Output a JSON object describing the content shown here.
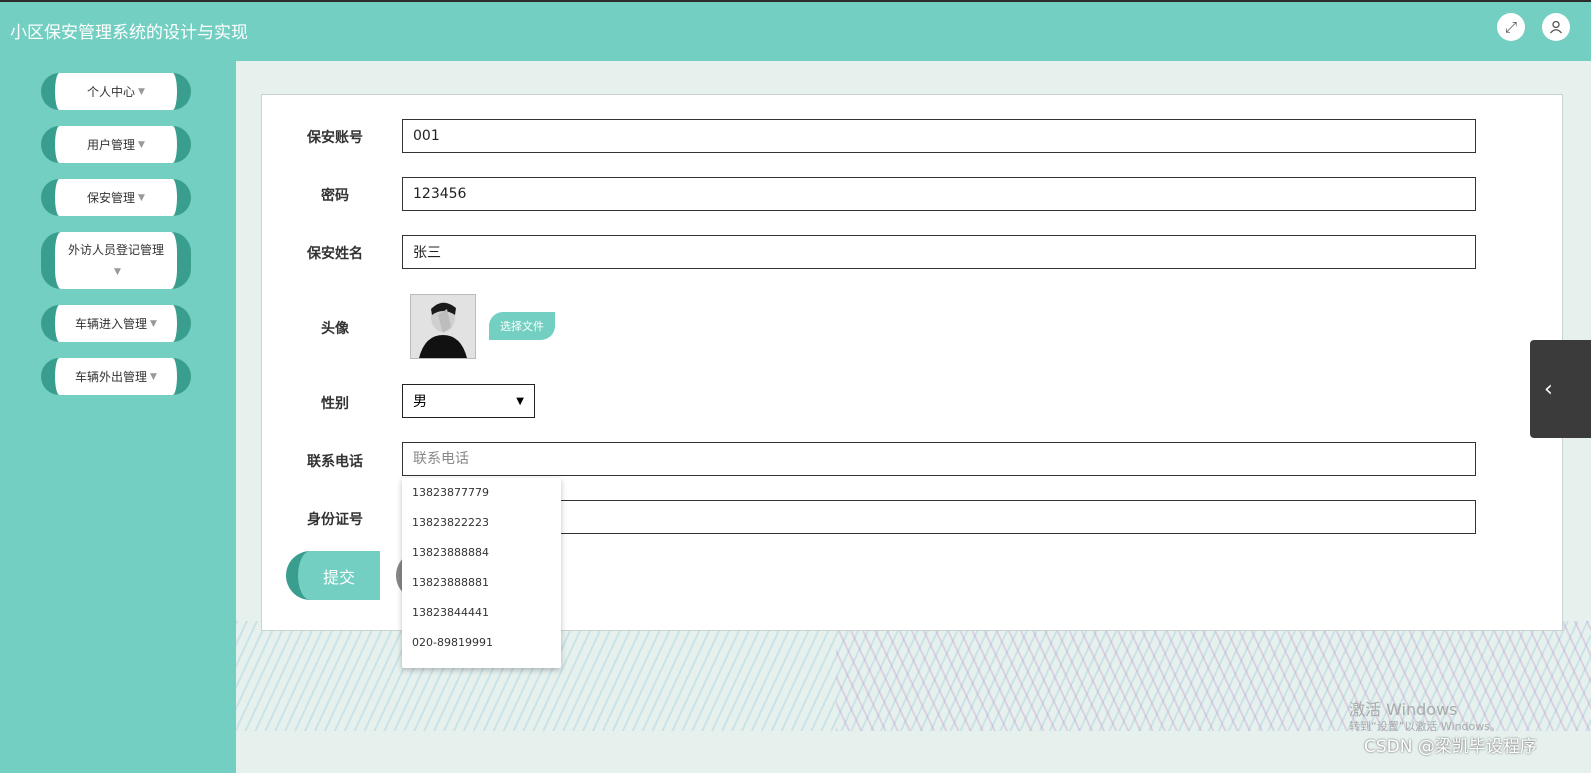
{
  "app": {
    "title": "小区保安管理系统的设计与实现"
  },
  "header": {
    "icons": [
      "fullscreen-icon",
      "user-icon"
    ]
  },
  "sidebar": {
    "items": [
      {
        "label": "个人中心"
      },
      {
        "label": "用户管理"
      },
      {
        "label": "保安管理"
      },
      {
        "label": "外访人员登记管理"
      },
      {
        "label": "车辆进入管理"
      },
      {
        "label": "车辆外出管理"
      }
    ]
  },
  "form": {
    "account": {
      "label": "保安账号",
      "value": "001"
    },
    "password": {
      "label": "密码",
      "value": "123456"
    },
    "name": {
      "label": "保安姓名",
      "value": "张三"
    },
    "avatar": {
      "label": "头像",
      "button": "选择文件"
    },
    "gender": {
      "label": "性别",
      "value": "男"
    },
    "phone": {
      "label": "联系电话",
      "placeholder": "联系电话"
    },
    "idcard": {
      "label": "身份证号"
    },
    "submit": "提交"
  },
  "autocomplete": {
    "options": [
      "13823877779",
      "13823822223",
      "13823888884",
      "13823888881",
      "13823844441",
      "020-89819991"
    ]
  },
  "watermark": {
    "line1": "激活 Windows",
    "line2": "转到“设置”以激活 Windows。",
    "line3": "CSDN @梁凯毕设程序"
  },
  "colors": {
    "primary": "#72cfc1",
    "accent": "#3a9e8f"
  }
}
